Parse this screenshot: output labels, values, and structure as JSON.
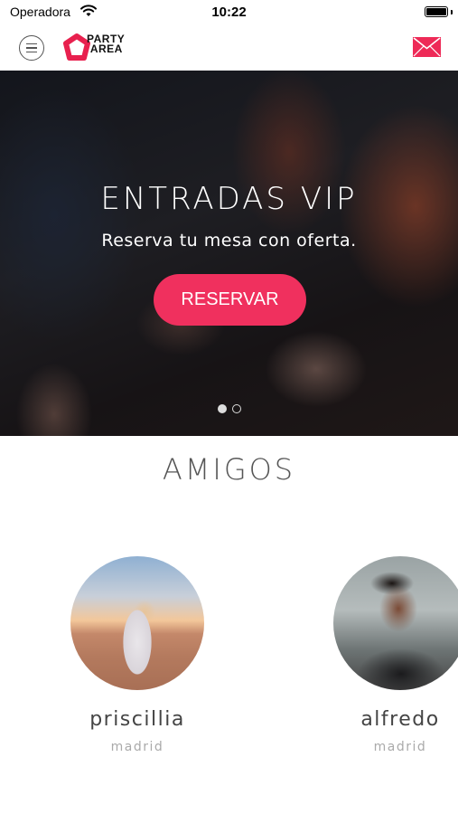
{
  "status_bar": {
    "carrier": "Operadora",
    "time": "10:22",
    "wifi_icon": "wifi-icon",
    "battery_icon": "battery-icon"
  },
  "header": {
    "menu_icon": "hamburger-menu-icon",
    "logo_text": "PARTY AREA",
    "mail_icon": "envelope-icon"
  },
  "hero": {
    "title": "ENTRADAS VIP",
    "subtitle": "Reserva tu mesa con oferta.",
    "button_label": "RESERVAR",
    "page_count": 2,
    "active_page": 1
  },
  "friends": {
    "title": "AMIGOS",
    "items": [
      {
        "name": "priscillia",
        "city": "madrid"
      },
      {
        "name": "alfredo",
        "city": "madrid"
      }
    ]
  },
  "colors": {
    "accent": "#f0305e",
    "text_dark": "#444444",
    "text_muted": "#aaaaaa"
  }
}
